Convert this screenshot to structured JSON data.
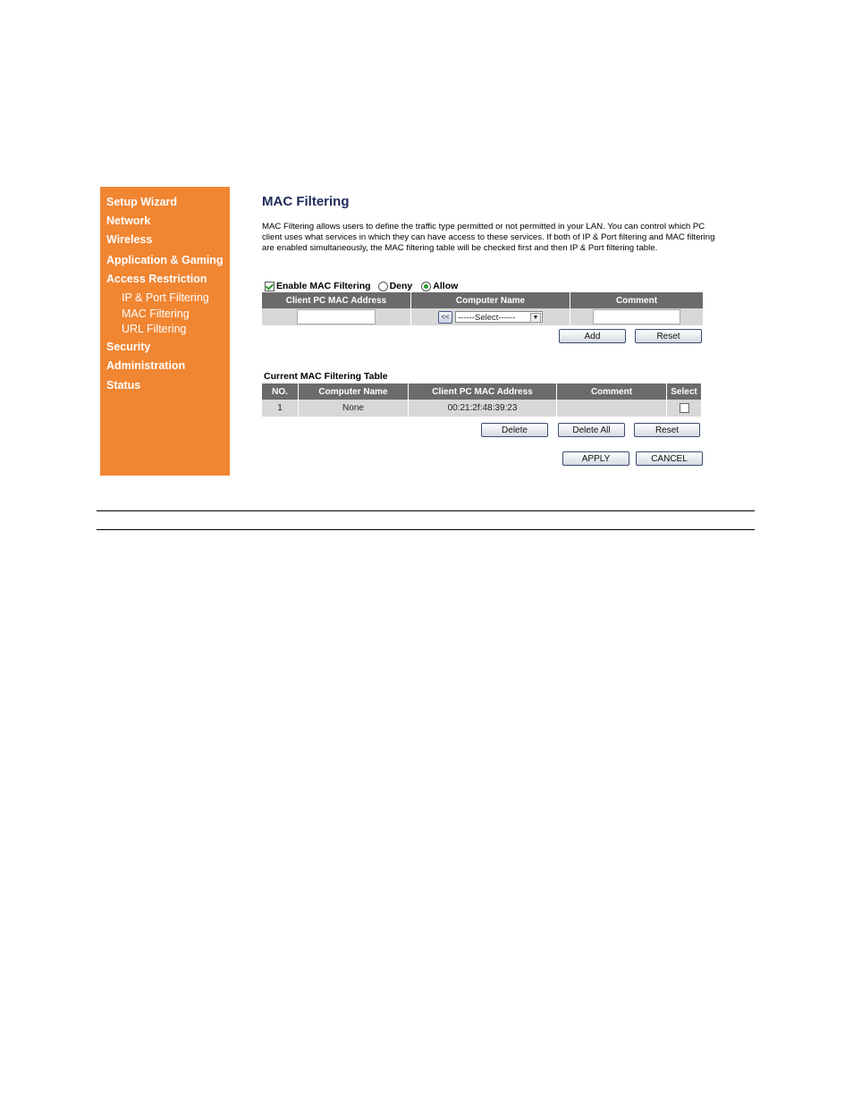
{
  "sidebar": {
    "items": [
      {
        "label": "Setup Wizard"
      },
      {
        "label": "Network"
      },
      {
        "label": "Wireless"
      },
      {
        "label": "Application & Gaming"
      },
      {
        "label": "Access Restriction"
      },
      {
        "label": "Security"
      },
      {
        "label": "Administration"
      },
      {
        "label": "Status"
      }
    ],
    "subitems": [
      {
        "label": "IP & Port Filtering"
      },
      {
        "label": "MAC Filtering"
      },
      {
        "label": "URL Filtering"
      }
    ],
    "color": "#f08532"
  },
  "main": {
    "title": "MAC Filtering",
    "description": "MAC Filtering allows users to define the traffic type permitted or not permitted in your LAN. You can control which PC client uses what services in which they can have access to these services. If both of IP & Port filtering and MAC filtering are enabled simultaneously, the MAC filtering table will be checked first and then IP & Port filtering table.",
    "enable_label": "Enable MAC Filtering",
    "enable_checked": true,
    "deny_label": "Deny",
    "allow_label": "Allow",
    "selected_mode": "Allow",
    "entry_table": {
      "headers": [
        "Client PC MAC Address",
        "Computer Name",
        "Comment"
      ],
      "mac_value": "",
      "copy_button": "<<",
      "computer_select": "------Select------",
      "comment_value": ""
    },
    "add_button": "Add",
    "reset_button": "Reset",
    "current_table": {
      "title": "Current MAC Filtering Table",
      "headers": [
        "NO.",
        "Computer Name",
        "Client PC MAC Address",
        "Comment",
        "Select"
      ],
      "rows": [
        {
          "no": "1",
          "name": "None",
          "mac": "00:21:2f:48:39:23",
          "comment": "",
          "selected": false
        }
      ]
    },
    "delete_button": "Delete",
    "delete_all_button": "Delete All",
    "reset2_button": "Reset",
    "apply_button": "APPLY",
    "cancel_button": "CANCEL"
  }
}
